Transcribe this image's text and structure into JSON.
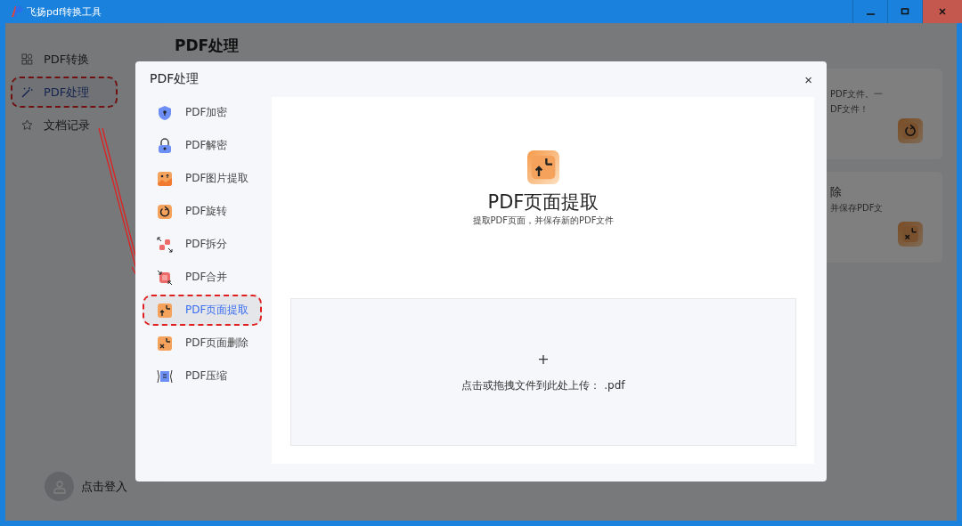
{
  "window": {
    "title": "飞扬pdf转换工具"
  },
  "sidebar": {
    "items": [
      {
        "label": "PDF转换",
        "kind": "grid",
        "selected": false,
        "highlighted": false
      },
      {
        "label": "PDF处理",
        "kind": "wand",
        "selected": true,
        "highlighted": true
      },
      {
        "label": "文档记录",
        "kind": "star",
        "selected": false,
        "highlighted": false
      }
    ],
    "login": "点击登入"
  },
  "page": {
    "title": "PDF处理",
    "cards": [
      {
        "lines": [
          "PDF文件。一",
          "DF文件！"
        ],
        "kind": "rotate"
      },
      {
        "title": "除",
        "lines": [
          "并保存PDF文"
        ],
        "kind": "delete"
      }
    ]
  },
  "dialog": {
    "title": "PDF处理",
    "close": "×",
    "tools": [
      {
        "label": "PDF加密",
        "kind": "shield",
        "selected": false,
        "highlighted": false
      },
      {
        "label": "PDF解密",
        "kind": "lock",
        "selected": false,
        "highlighted": false
      },
      {
        "label": "PDF图片提取",
        "kind": "image",
        "selected": false,
        "highlighted": false
      },
      {
        "label": "PDF旋转",
        "kind": "rotate",
        "selected": false,
        "highlighted": false
      },
      {
        "label": "PDF拆分",
        "kind": "split",
        "selected": false,
        "highlighted": false
      },
      {
        "label": "PDF合并",
        "kind": "merge",
        "selected": false,
        "highlighted": false
      },
      {
        "label": "PDF页面提取",
        "kind": "extract",
        "selected": true,
        "highlighted": true
      },
      {
        "label": "PDF页面删除",
        "kind": "delete",
        "selected": false,
        "highlighted": false
      },
      {
        "label": "PDF压缩",
        "kind": "compress",
        "selected": false,
        "highlighted": false
      }
    ],
    "tool_title": "PDF页面提取",
    "tool_description": "提取PDF页面，并保存新的PDF文件",
    "upload": {
      "plus": "+",
      "hint": "点击或拖拽文件到此处上传： .pdf"
    }
  }
}
